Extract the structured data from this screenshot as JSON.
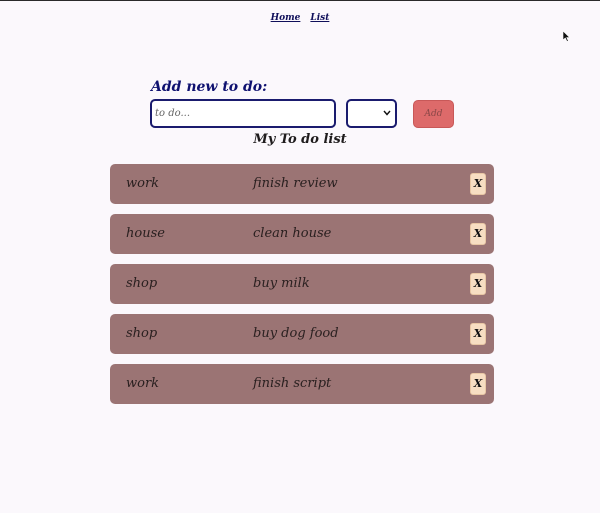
{
  "nav": {
    "home_label": "Home",
    "list_label": "List"
  },
  "form": {
    "title": "Add new to do:",
    "input_placeholder": "to do...",
    "input_value": "",
    "category_selected": "",
    "add_label": "Add"
  },
  "list": {
    "title": "My To do list",
    "items": [
      {
        "category": "work",
        "task": "finish review",
        "delete_label": "X"
      },
      {
        "category": "house",
        "task": "clean house",
        "delete_label": "X"
      },
      {
        "category": "shop",
        "task": "buy milk",
        "delete_label": "X"
      },
      {
        "category": "shop",
        "task": "buy dog food",
        "delete_label": "X"
      },
      {
        "category": "work",
        "task": "finish script",
        "delete_label": "X"
      }
    ]
  },
  "colors": {
    "background": "#fbf8fc",
    "item_bg": "#9b7474",
    "add_button": "#dd6a6a",
    "delete_button": "#f7dec2",
    "heading_blue": "#0f1170"
  },
  "icons": {
    "cursor": "mouse-pointer-icon",
    "select_arrow": "chevron-down-icon"
  }
}
